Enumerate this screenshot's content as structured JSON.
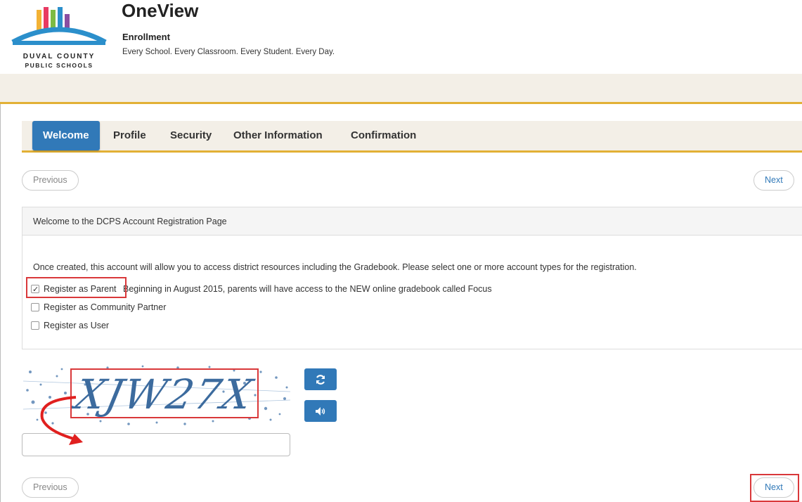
{
  "header": {
    "logo_line1": "DUVAL COUNTY",
    "logo_line2": "PUBLIC SCHOOLS",
    "title": "OneView",
    "subtitle": "Enrollment",
    "tagline": "Every School. Every Classroom. Every Student. Every Day."
  },
  "tabs": [
    {
      "label": "Welcome",
      "active": true
    },
    {
      "label": "Profile",
      "active": false
    },
    {
      "label": "Security",
      "active": false
    },
    {
      "label": "Other Information",
      "active": false
    },
    {
      "label": "Confirmation",
      "active": false
    }
  ],
  "nav": {
    "previous_label": "Previous",
    "next_label": "Next"
  },
  "panel": {
    "heading": "Welcome to the DCPS Account Registration Page",
    "intro": "Once created, this account will allow you to access district resources including the Gradebook. Please select one or more account types for the registration.",
    "options": [
      {
        "label": "Register as Parent",
        "checked": true,
        "note": "Beginning in August 2015, parents will have access to the NEW online gradebook called Focus"
      },
      {
        "label": "Register as Community Partner",
        "checked": false,
        "note": ""
      },
      {
        "label": "Register as User",
        "checked": false,
        "note": ""
      }
    ]
  },
  "captcha": {
    "code": "XJW27X",
    "refresh_icon": "refresh-icon",
    "audio_icon": "audio-icon",
    "input_value": ""
  },
  "colors": {
    "primary": "#3179b8",
    "accent": "#e2b035",
    "band": "#f3efe7",
    "highlight": "#d9383a"
  }
}
